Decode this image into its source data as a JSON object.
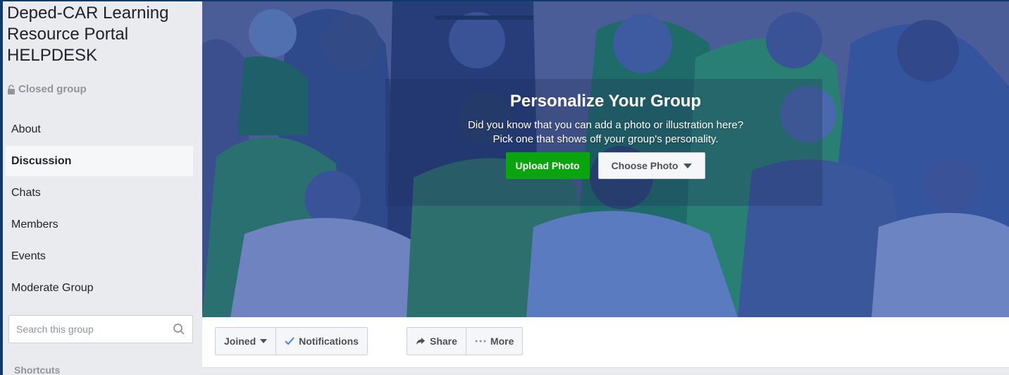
{
  "group": {
    "title": "Deped-CAR Learning Resource Portal HELPDESK",
    "type": "Closed group"
  },
  "nav": {
    "items": [
      {
        "label": "About",
        "active": false
      },
      {
        "label": "Discussion",
        "active": true
      },
      {
        "label": "Chats",
        "active": false
      },
      {
        "label": "Members",
        "active": false
      },
      {
        "label": "Events",
        "active": false
      },
      {
        "label": "Moderate Group",
        "active": false
      }
    ]
  },
  "search": {
    "placeholder": "Search this group",
    "icon": "magnifier-icon"
  },
  "shortcuts_label": "Shortcuts",
  "cover": {
    "heading": "Personalize Your Group",
    "description_line1": "Did you know that you can add a photo or illustration here?",
    "description_line2": "Pick one that shows off your group's personality.",
    "upload_label": "Upload Photo",
    "choose_label": "Choose Photo"
  },
  "actions": {
    "joined_label": "Joined",
    "notifications_label": "Notifications",
    "share_label": "Share",
    "more_label": "More"
  },
  "colors": {
    "upload_green": "#0aa50e",
    "cover_blue": "#4d5f9a",
    "check_blue": "#4080ff",
    "frame_navy": "#0f3b66"
  }
}
